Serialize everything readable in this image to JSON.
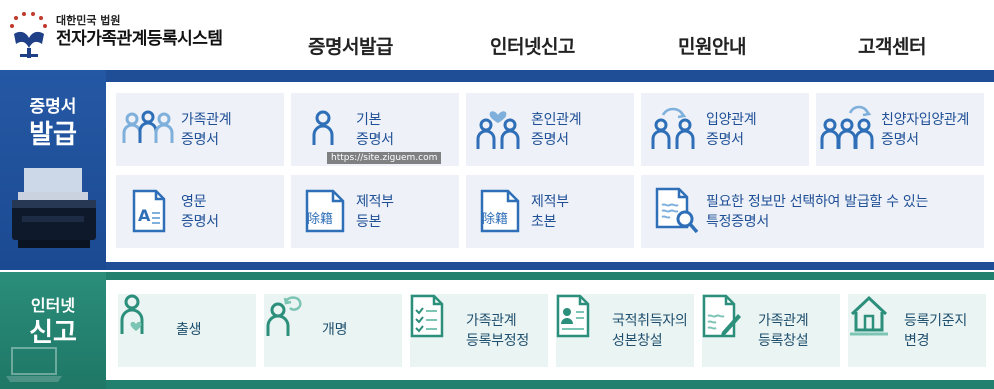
{
  "header": {
    "org_small": "대한민국 법원",
    "system_name": "전자가족관계등록시스템",
    "nav": [
      {
        "label": "증명서발급"
      },
      {
        "label": "인터넷신고"
      },
      {
        "label": "민원안내"
      },
      {
        "label": "고객센터"
      }
    ]
  },
  "certificates": {
    "side_line1": "증명서",
    "side_line2": "발급",
    "cards": [
      {
        "line1": "가족관계",
        "line2": "증명서",
        "icon": "family-icon"
      },
      {
        "line1": "기본",
        "line2": "증명서",
        "icon": "person-icon"
      },
      {
        "line1": "혼인관계",
        "line2": "증명서",
        "icon": "marriage-icon"
      },
      {
        "line1": "입양관계",
        "line2": "증명서",
        "icon": "adoption-icon"
      },
      {
        "line1": "친양자입양관계",
        "line2": "증명서",
        "icon": "full-adoption-icon"
      },
      {
        "line1": "영문",
        "line2": "증명서",
        "icon": "english-document-icon"
      },
      {
        "line1": "제적부",
        "line2": "등본",
        "icon": "removed-register-document-icon"
      },
      {
        "line1": "제적부",
        "line2": "초본",
        "icon": "removed-register-extract-icon"
      },
      {
        "line1": "필요한 정보만 선택하여 발급할 수 있는",
        "line2": "특정증명서",
        "icon": "document-search-icon"
      }
    ],
    "doc_glyph_a": "A",
    "doc_glyph_chinese": "除籍"
  },
  "internet_report": {
    "side_line1": "인터넷",
    "side_line2": "신고",
    "cards": [
      {
        "line1": "출생",
        "line2": "",
        "icon": "birth-icon"
      },
      {
        "line1": "개명",
        "line2": "",
        "icon": "rename-icon"
      },
      {
        "line1": "가족관계",
        "line2": "등록부정정",
        "icon": "checklist-icon"
      },
      {
        "line1": "국적취득자의",
        "line2": "성본창설",
        "icon": "id-card-icon"
      },
      {
        "line1": "가족관계",
        "line2": "등록창설",
        "icon": "document-pen-icon"
      },
      {
        "line1": "등록기준지",
        "line2": "변경",
        "icon": "house-icon"
      }
    ]
  },
  "watermark": "https://site.ziguem.com",
  "colors": {
    "navy": "#1f4e96",
    "teal": "#21806e",
    "card_blue": "#eef2f8",
    "card_teal": "#eaf4f2",
    "icon_blue": "#2f6fb8",
    "icon_light": "#7fb0dc",
    "icon_teal": "#2c8f7b"
  }
}
